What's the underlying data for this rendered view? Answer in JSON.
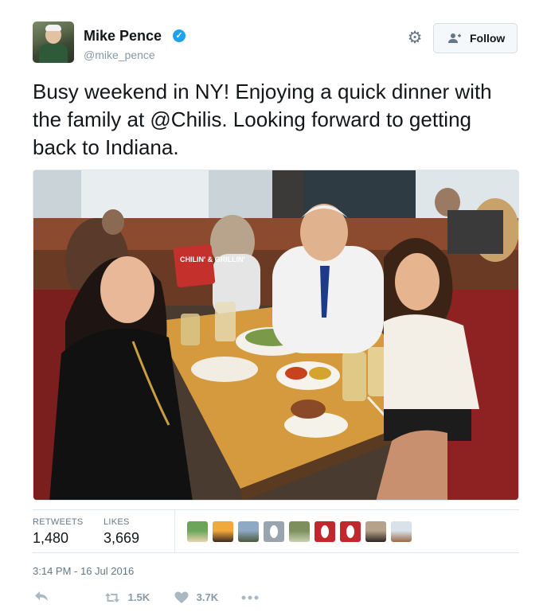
{
  "author": {
    "name": "Mike Pence",
    "handle": "@mike_pence",
    "verified_mark": "✓"
  },
  "follow": {
    "label": "Follow",
    "icon": "person-add-icon"
  },
  "settings_icon": "gear-icon",
  "tweet": {
    "text": "Busy weekend in NY! Enjoying a quick dinner with the family at @Chilis. Looking forward to getting back to Indiana."
  },
  "photo": {
    "sign_text": "CHILIN' & GRILLIN'"
  },
  "stats": {
    "retweets_label": "RETWEETS",
    "retweets_value": "1,480",
    "likes_label": "LIKES",
    "likes_value": "3,669"
  },
  "likers": [
    {
      "colors": [
        "#6aa55a",
        "#e8d4b0"
      ]
    },
    {
      "colors": [
        "#f2a93b",
        "#3a2a1e"
      ]
    },
    {
      "colors": [
        "#8fa8c6",
        "#4a5a3a"
      ]
    },
    {
      "colors": [
        "#9aa4ae",
        "#ffffff"
      ]
    },
    {
      "colors": [
        "#7d8f5d",
        "#c9d1b0"
      ]
    },
    {
      "colors": [
        "#c1272d",
        "#ffffff"
      ]
    },
    {
      "colors": [
        "#c1272d",
        "#ffffff"
      ]
    },
    {
      "colors": [
        "#b6a28a",
        "#2e2520"
      ]
    },
    {
      "colors": [
        "#d9e2ea",
        "#9a6a4a"
      ]
    }
  ],
  "timestamp": "3:14 PM - 16 Jul 2016",
  "actions": {
    "reply_icon": "reply-icon",
    "retweet_icon": "retweet-icon",
    "retweet_count": "1.5K",
    "like_icon": "heart-icon",
    "like_count": "3.7K",
    "more_icon": "more-icon"
  },
  "colors": {
    "link": "#1da1f2",
    "text": "#14171a",
    "muted": "#657786",
    "border": "#e1e8ed"
  }
}
